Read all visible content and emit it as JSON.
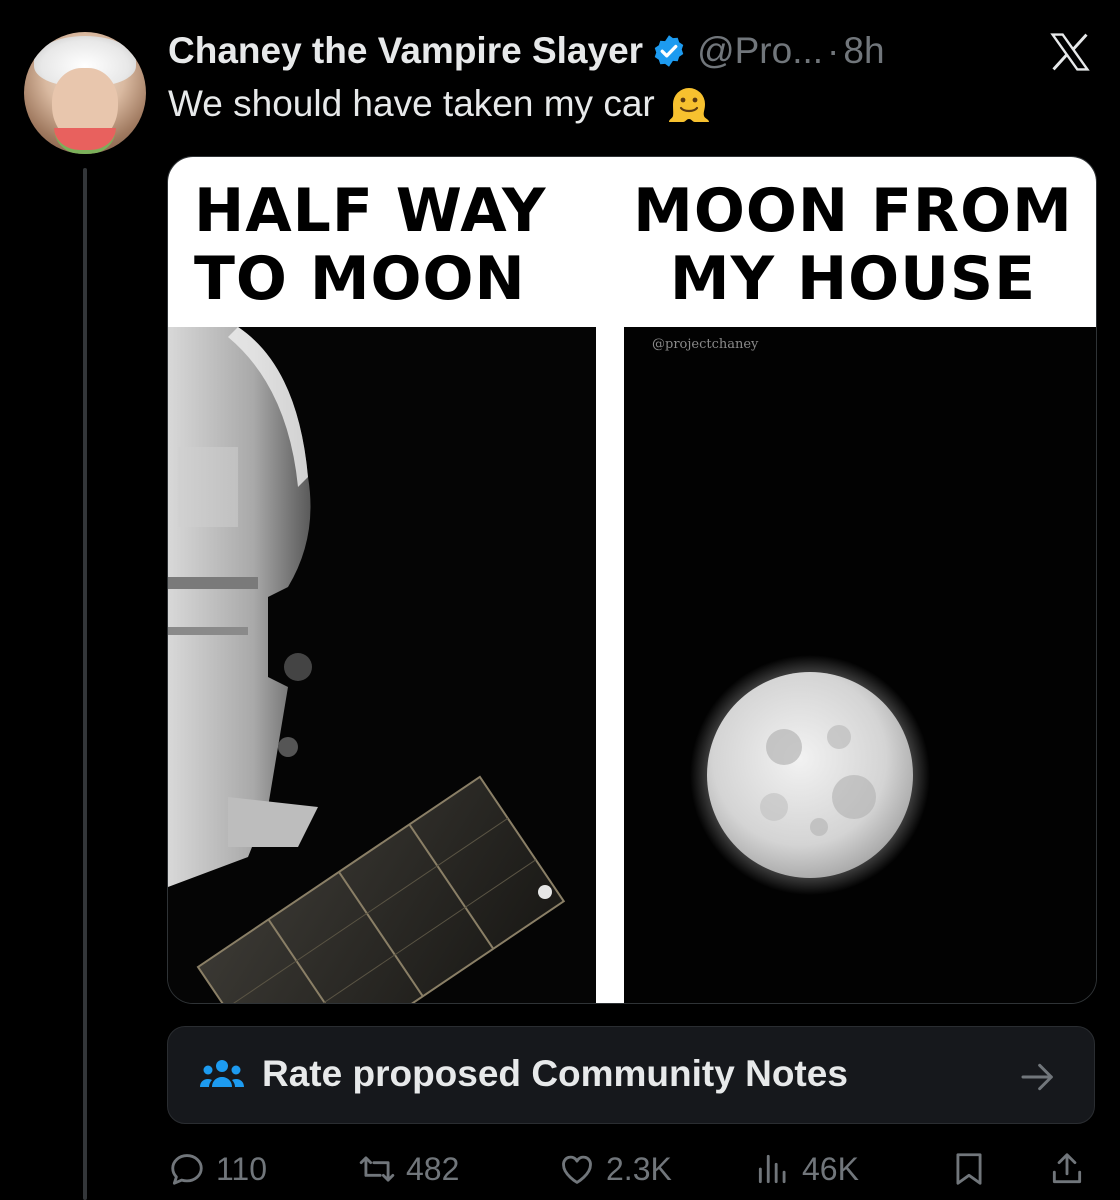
{
  "author": {
    "display_name": "Chaney the Vampire Slayer",
    "handle": "@Pro...",
    "separator": "·",
    "time": "8h",
    "verified_icon": "verified-badge-icon"
  },
  "tweet": {
    "text": "We should have taken my car",
    "emoji": "melting-face-emoji"
  },
  "media": {
    "left_title": "HALF WAY\nTO MOON",
    "right_title": "MOON FROM\nMY HOUSE",
    "watermark": "@projectchaney"
  },
  "community_notes": {
    "label": "Rate proposed Community Notes",
    "icon": "community-icon",
    "arrow_icon": "arrow-right-icon"
  },
  "actions": {
    "replies": "110",
    "reposts": "482",
    "likes": "2.3K",
    "views": "46K"
  },
  "colors": {
    "background": "#000000",
    "text": "#e7e9ea",
    "muted": "#71767b",
    "verified": "#1d9bf0",
    "card": "#16181c"
  }
}
